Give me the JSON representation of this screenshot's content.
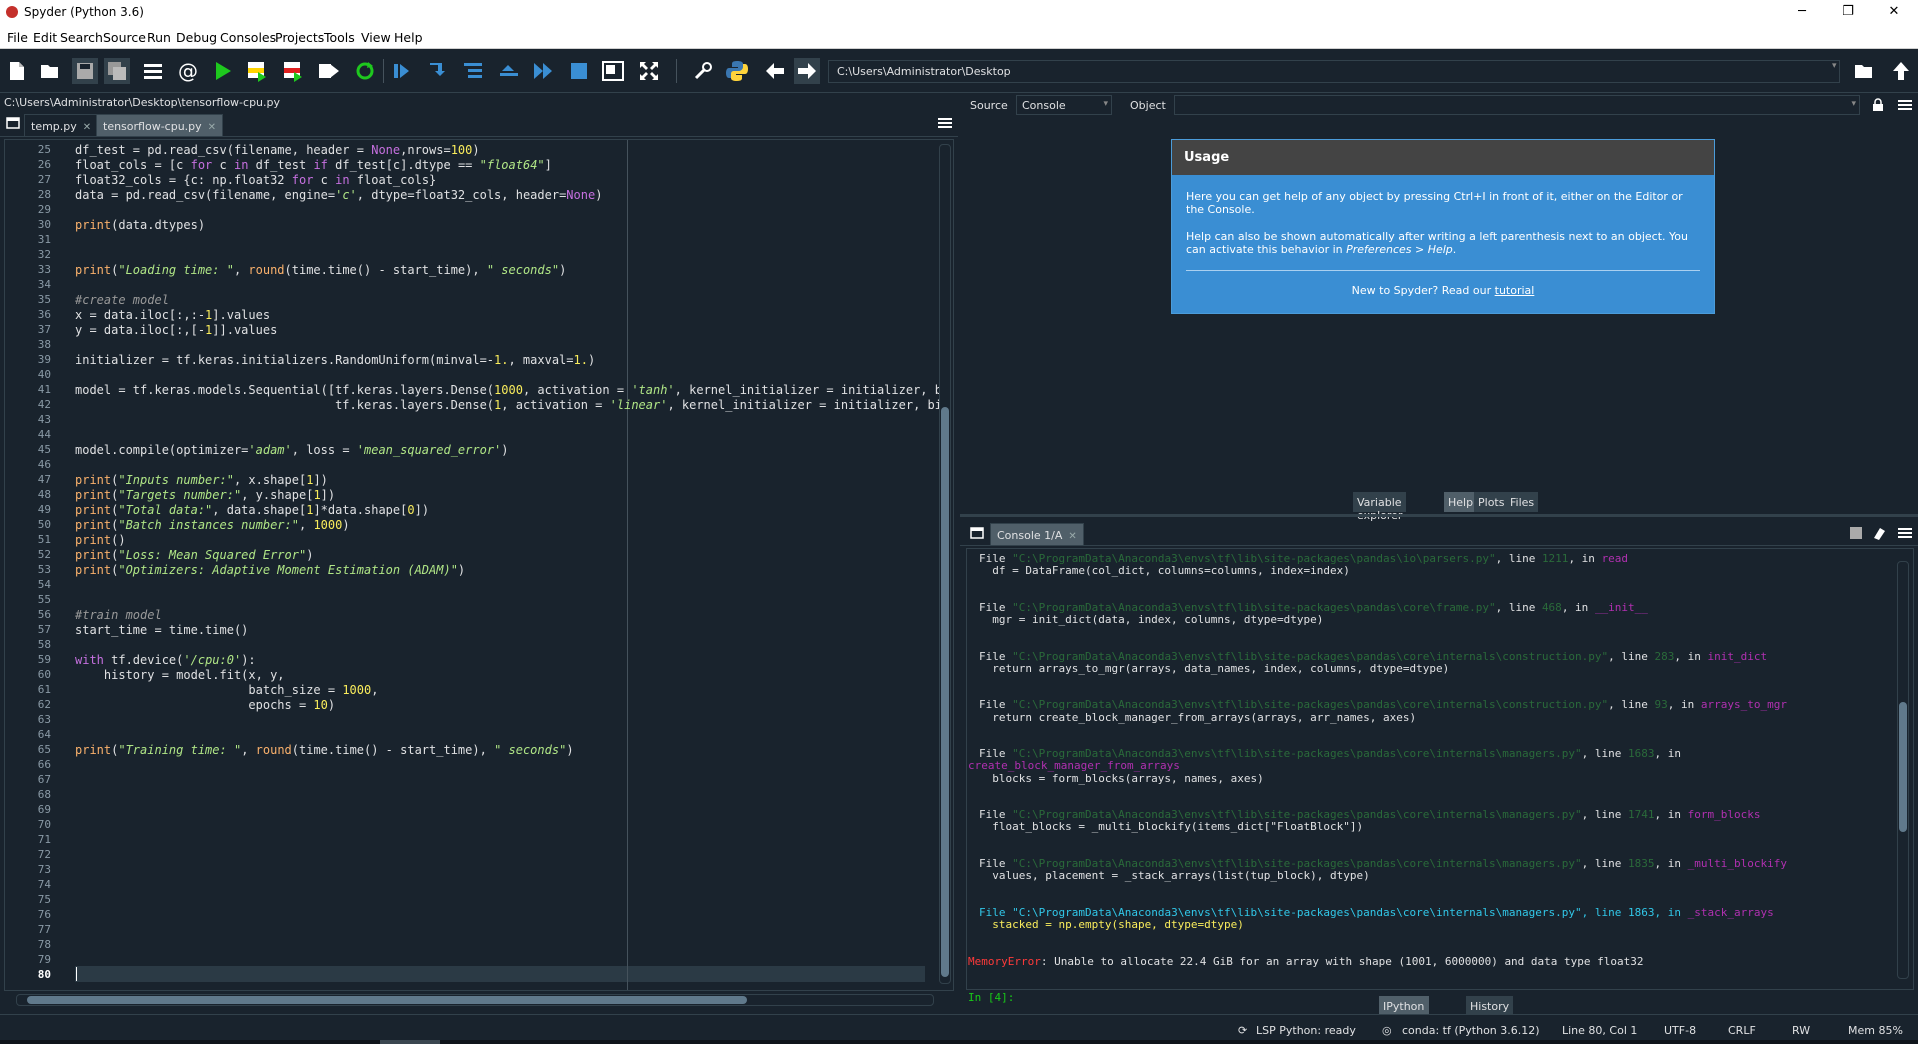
{
  "window": {
    "title": "Spyder (Python 3.6)",
    "controls": [
      "─",
      "❐",
      "✕"
    ]
  },
  "menu": [
    "File",
    "Edit",
    "Search",
    "Source",
    "Run",
    "Debug",
    "Consoles",
    "Projects",
    "Tools",
    "View",
    "Help"
  ],
  "toolbar": {
    "path": "C:\\Users\\Administrator\\Desktop",
    "icons": [
      "new-file-icon",
      "open-file-icon",
      "save-icon",
      "save-all-icon",
      "outline-icon",
      "at-icon",
      "run-icon",
      "run-cell-icon",
      "run-cell-advance-icon",
      "run-selection-icon",
      "rerun-icon",
      "debug-icon",
      "step-icon",
      "step-into-icon",
      "step-return-icon",
      "continue-icon",
      "stop-icon",
      "maximize-pane-icon",
      "fullscreen-icon",
      "preferences-icon",
      "python-path-icon",
      "back-arrow-icon",
      "forward-arrow-icon",
      "browse-folder-icon",
      "parent-dir-icon"
    ]
  },
  "editor": {
    "filepath": "C:\\Users\\Administrator\\Desktop\\tensorflow-cpu.py",
    "tabs": [
      {
        "label": "temp.py",
        "close": "✕"
      },
      {
        "label": "tensorflow-cpu.py",
        "close": "✕"
      }
    ],
    "line_numbers": [
      "25",
      "26",
      "27",
      "28",
      "29",
      "30",
      "31",
      "32",
      "33",
      "34",
      "35",
      "36",
      "37",
      "38",
      "39",
      "40",
      "41",
      "42",
      "43",
      "44",
      "45",
      "46",
      "47",
      "48",
      "49",
      "50",
      "51",
      "52",
      "53",
      "54",
      "55",
      "56",
      "57",
      "58",
      "59",
      "60",
      "61",
      "62",
      "63",
      "64",
      "65",
      "66",
      "67",
      "68",
      "69",
      "70",
      "71",
      "72",
      "73",
      "74",
      "75",
      "76",
      "77",
      "78",
      "79",
      "80"
    ],
    "lines": {
      "l25": [
        "df_test = pd.read_csv(filename, header = ",
        "None",
        ",nrows=",
        "100",
        ")"
      ],
      "l26": [
        "float_cols = [c ",
        "for",
        " c ",
        "in",
        " df_test ",
        "if",
        " df_test[c].dtype == ",
        "\"float64\"",
        "]"
      ],
      "l27": [
        "float32_cols = {c: np.float32 ",
        "for",
        " c ",
        "in",
        " float_cols}"
      ],
      "l28": [
        "data = pd.read_csv(filename, engine=",
        "'c'",
        ", dtype=float32_cols, header=",
        "None",
        ")"
      ],
      "l30": [
        "print",
        "(data.dtypes)"
      ],
      "l33": [
        "print",
        "(",
        "\"Loading time: \"",
        ", ",
        "round",
        "(time.time() - start_time), ",
        "\" seconds\"",
        ")"
      ],
      "l35": [
        "#create model"
      ],
      "l36": [
        "x = data.iloc[:,:-",
        "1",
        "].values"
      ],
      "l37": [
        "y = data.iloc[:,[-",
        "1",
        "]].values"
      ],
      "l39": [
        "initializer = tf.keras.initializers.RandomUniform(minval=-",
        "1.",
        ", maxval=",
        "1.",
        ")"
      ],
      "l41": [
        "model = tf.keras.models.Sequential([tf.keras.layers.Dense(",
        "1000",
        ", activation = ",
        "'tanh'",
        ", kernel_initializer = initializer, bi"
      ],
      "l42": [
        "                                    tf.keras.layers.Dense(",
        "1",
        ", activation = ",
        "'linear'",
        ", kernel_initializer = initializer, bia"
      ],
      "l45": [
        "model.compile(optimizer=",
        "'adam'",
        ", loss = ",
        "'mean_squared_error'",
        ")"
      ],
      "l47": [
        "print",
        "(",
        "\"Inputs number:\"",
        ", x.shape[",
        "1",
        "])"
      ],
      "l48": [
        "print",
        "(",
        "\"Targets number:\"",
        ", y.shape[",
        "1",
        "])"
      ],
      "l49": [
        "print",
        "(",
        "\"Total data:\"",
        ", data.shape[",
        "1",
        "]*data.shape[",
        "0",
        "])"
      ],
      "l50": [
        "print",
        "(",
        "\"Batch instances number:\"",
        ", ",
        "1000",
        ")"
      ],
      "l51": [
        "print",
        "()"
      ],
      "l52": [
        "print",
        "(",
        "\"Loss: Mean Squared Error\"",
        ")"
      ],
      "l53": [
        "print",
        "(",
        "\"Optimizers: Adaptive Moment Estimation (ADAM)\"",
        ")"
      ],
      "l56": [
        "#train model"
      ],
      "l57": [
        "start_time = time.time()"
      ],
      "l59": [
        "with",
        " tf.device(",
        "'/cpu:0'",
        "):"
      ],
      "l60": [
        "    history = model.fit(x, y,"
      ],
      "l61": [
        "                        batch_size = ",
        "1000",
        ","
      ],
      "l62": [
        "                        epochs = ",
        "10",
        ")"
      ],
      "l65": [
        "print",
        "(",
        "\"Training time: \"",
        ", ",
        "round",
        "(time.time() - start_time), ",
        "\" seconds\"",
        ")"
      ]
    }
  },
  "help": {
    "source_label": "Source",
    "source_value": "Console",
    "object_label": "Object",
    "usage_title": "Usage",
    "usage_p1": "Here you can get help of any object by pressing Ctrl+I in front of it, either on the Editor or the Console.",
    "usage_p2a": "Help can also be shown automatically after writing a left parenthesis next to an object. You can activate this behavior in ",
    "usage_p2b": "Preferences > Help",
    "usage_p2c": ".",
    "usage_foot": "New to Spyder? Read our ",
    "usage_link": "tutorial",
    "pane_tabs": [
      "Variable explorer",
      "Help",
      "Plots",
      "Files"
    ]
  },
  "console": {
    "tab": "Console 1/A",
    "tab_close": "✕",
    "lines": [
      {
        "kind": "trace",
        "file": "\"C:\\ProgramData\\Anaconda3\\envs\\tf\\lib\\site-packages\\pandas\\io\\parsers.py\"",
        "line": "1211",
        "func": "read"
      },
      {
        "kind": "code",
        "text": "  df = DataFrame(col_dict, columns=columns, index=index)"
      },
      {
        "kind": "trace",
        "file": "\"C:\\ProgramData\\Anaconda3\\envs\\tf\\lib\\site-packages\\pandas\\core\\frame.py\"",
        "line": "468",
        "func": "__init__"
      },
      {
        "kind": "code",
        "text": "  mgr = init_dict(data, index, columns, dtype=dtype)"
      },
      {
        "kind": "trace",
        "file": "\"C:\\ProgramData\\Anaconda3\\envs\\tf\\lib\\site-packages\\pandas\\core\\internals\\construction.py\"",
        "line": "283",
        "func": "init_dict"
      },
      {
        "kind": "code",
        "text": "  return arrays_to_mgr(arrays, data_names, index, columns, dtype=dtype)"
      },
      {
        "kind": "trace",
        "file": "\"C:\\ProgramData\\Anaconda3\\envs\\tf\\lib\\site-packages\\pandas\\core\\internals\\construction.py\"",
        "line": "93",
        "func": "arrays_to_mgr"
      },
      {
        "kind": "code",
        "text": "  return create_block_manager_from_arrays(arrays, arr_names, axes)"
      },
      {
        "kind": "trace",
        "file": "\"C:\\ProgramData\\Anaconda3\\envs\\tf\\lib\\site-packages\\pandas\\core\\internals\\managers.py\"",
        "line": "1683",
        "func": ""
      },
      {
        "kind": "fnonly",
        "text": "create_block_manager_from_arrays"
      },
      {
        "kind": "code",
        "text": "  blocks = form_blocks(arrays, names, axes)"
      },
      {
        "kind": "trace",
        "file": "\"C:\\ProgramData\\Anaconda3\\envs\\tf\\lib\\site-packages\\pandas\\core\\internals\\managers.py\"",
        "line": "1741",
        "func": "form_blocks"
      },
      {
        "kind": "code",
        "text": "  float_blocks = _multi_blockify(items_dict[\"FloatBlock\"])"
      },
      {
        "kind": "trace",
        "file": "\"C:\\ProgramData\\Anaconda3\\envs\\tf\\lib\\site-packages\\pandas\\core\\internals\\managers.py\"",
        "line": "1835",
        "func": "_multi_blockify"
      },
      {
        "kind": "code",
        "text": "  values, placement = _stack_arrays(list(tup_block), dtype)"
      },
      {
        "kind": "trace_last",
        "file": "\"C:\\ProgramData\\Anaconda3\\envs\\tf\\lib\\site-packages\\pandas\\core\\internals\\managers.py\"",
        "line": "1863",
        "func": "_stack_arrays"
      },
      {
        "kind": "code_last",
        "text": "  stacked = np.empty(shape, dtype=dtype)"
      },
      {
        "kind": "error",
        "name": "MemoryError",
        "text": ": Unable to allocate 22.4 GiB for an array with shape (1001, 6000000) and data type float32"
      },
      {
        "kind": "prompt",
        "text": "In [4]:"
      }
    ],
    "pane_tabs": [
      "IPython console",
      "History"
    ]
  },
  "status": {
    "lsp": "LSP Python: ready",
    "conda": "conda: tf (Python 3.6.12)",
    "position": "Line 80, Col 1",
    "encoding": "UTF-8",
    "eol": "CRLF",
    "rw": "RW",
    "mem": "Mem 85%"
  }
}
